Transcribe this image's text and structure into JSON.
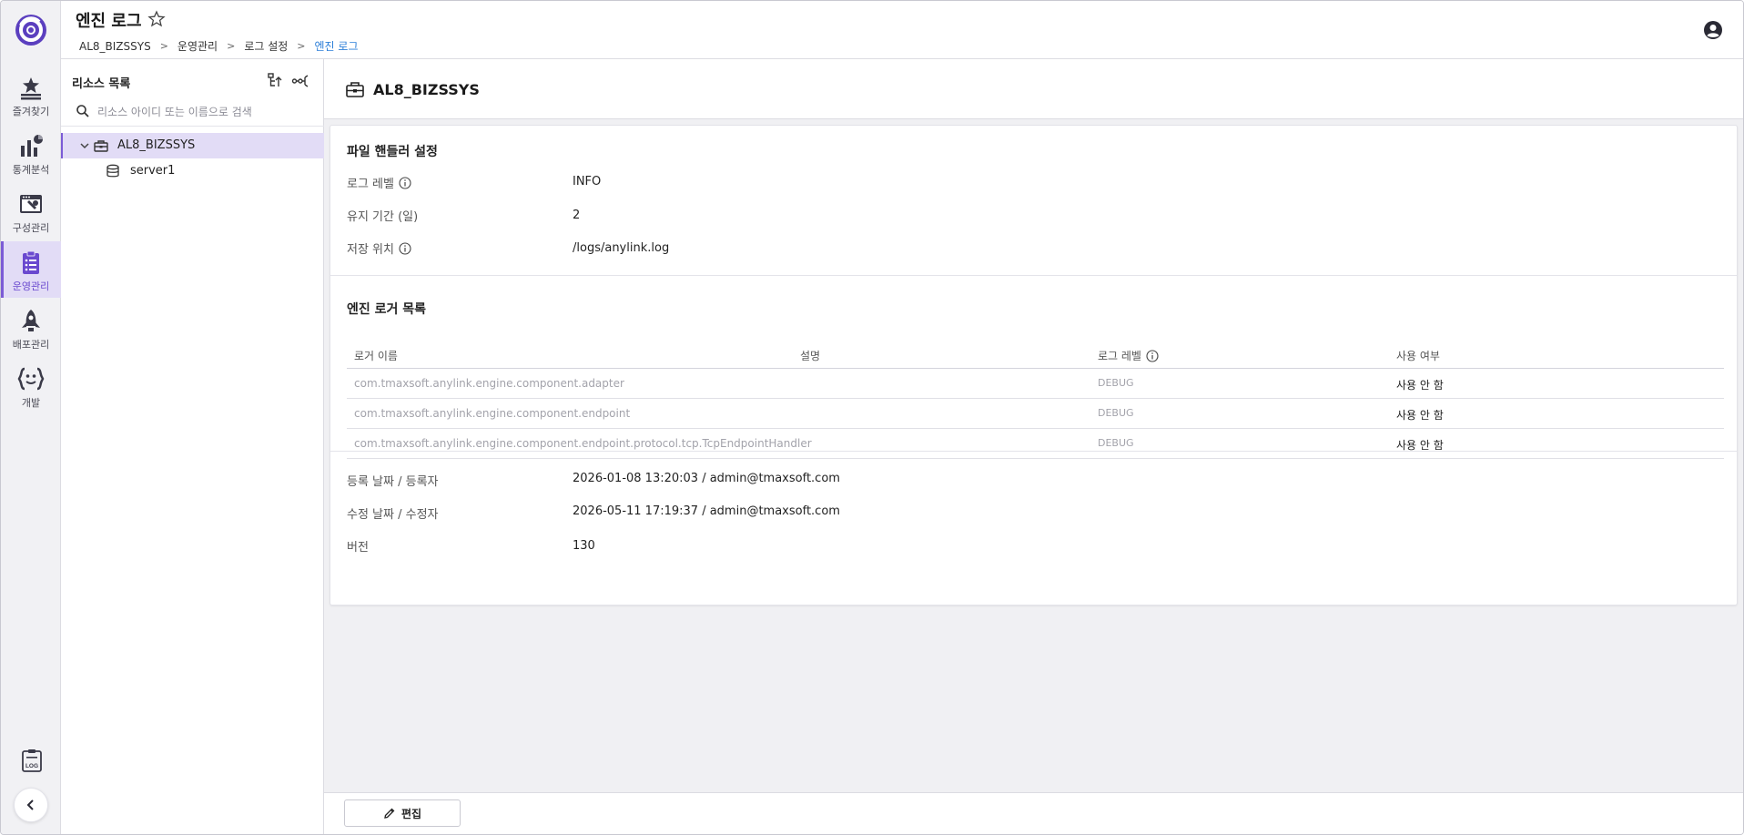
{
  "header": {
    "title": "엔진 로그",
    "breadcrumb": [
      "AL8_BIZSSYS",
      "운영관리",
      "로그 설정",
      "엔진 로그"
    ]
  },
  "nav": {
    "items": [
      {
        "label": "즐겨찾기",
        "icon": "star-list-icon"
      },
      {
        "label": "통계분석",
        "icon": "chart-icon"
      },
      {
        "label": "구성관리",
        "icon": "config-tool-icon"
      },
      {
        "label": "운영관리",
        "icon": "clipboard-icon",
        "active": true
      },
      {
        "label": "배포관리",
        "icon": "rocket-icon"
      },
      {
        "label": "개발",
        "icon": "code-braces-icon"
      }
    ],
    "accent_color": "#7b5bd6",
    "active_bg": "#e2dcf6"
  },
  "resources": {
    "title": "리소스 목록",
    "search_placeholder": "리소스 아이디 또는 이름으로 검색",
    "tree": [
      {
        "label": "AL8_BIZSSYS",
        "icon": "toolbox-icon",
        "expanded": true,
        "selected": true
      },
      {
        "label": "server1",
        "icon": "database-icon"
      }
    ]
  },
  "main": {
    "title": "AL8_BIZSSYS",
    "file_handler": {
      "title": "파일 핸들러 설정",
      "rows": [
        {
          "label": "로그 레벨",
          "value": "INFO",
          "info": true
        },
        {
          "label": "유지 기간 (일)",
          "value": "2",
          "info": false
        },
        {
          "label": "저장 위치",
          "value": "/logs/anylink.log",
          "info": true
        }
      ]
    },
    "loggers": {
      "title": "엔진 로거 목록",
      "columns": [
        "로거 이름",
        "설명",
        "로그 레벨",
        "사용 여부"
      ],
      "rows": [
        {
          "name": "com.tmaxsoft.anylink.engine.component.adapter",
          "desc": "",
          "level": "DEBUG",
          "use": "사용 안 함"
        },
        {
          "name": "com.tmaxsoft.anylink.engine.component.endpoint",
          "desc": "",
          "level": "DEBUG",
          "use": "사용 안 함"
        },
        {
          "name": "com.tmaxsoft.anylink.engine.component.endpoint.protocol.tcp.TcpEndpointHandler",
          "desc": "",
          "level": "DEBUG",
          "use": "사용 안 함"
        }
      ]
    },
    "meta": [
      {
        "label": "등록 날짜 / 등록자",
        "value": "2026-01-08 13:20:03 / admin@tmaxsoft.com"
      },
      {
        "label": "수정 날짜 / 수정자",
        "value": "2026-05-11 17:19:37 / admin@tmaxsoft.com"
      },
      {
        "label": "버전",
        "value": "130"
      }
    ]
  },
  "footer": {
    "edit_label": "편집"
  }
}
